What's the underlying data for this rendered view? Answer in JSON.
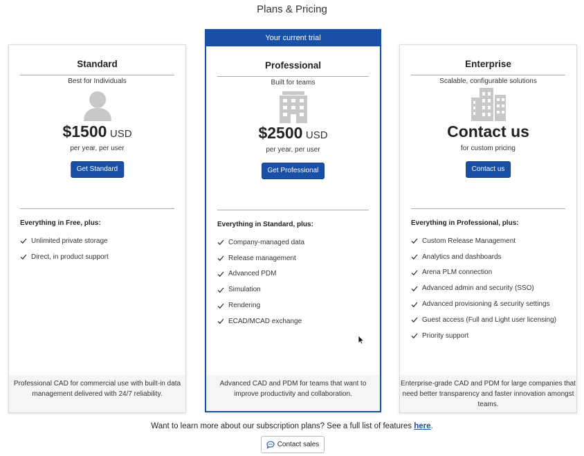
{
  "page": {
    "title": "Plans & Pricing"
  },
  "plans": [
    {
      "name": "Standard",
      "tagline": "Best for Individuals",
      "icon": "person-icon",
      "price": "$1500",
      "currency": "USD",
      "price_sub": "per year, per user",
      "cta": "Get Standard",
      "features_heading": "Everything in Free, plus:",
      "features": [
        "Unlimited private storage",
        "Direct, in product support"
      ],
      "description": "Professional CAD for commercial use with built-in data management delivered with 24/7 reliability."
    },
    {
      "banner": "Your current trial",
      "name": "Professional",
      "tagline": "Built for teams",
      "icon": "building-icon",
      "price": "$2500",
      "currency": "USD",
      "price_sub": "per year, per user",
      "cta": "Get Professional",
      "features_heading": "Everything in Standard, plus:",
      "features": [
        "Company-managed data",
        "Release management",
        "Advanced PDM",
        "Simulation",
        "Rendering",
        "ECAD/MCAD exchange"
      ],
      "description": "Advanced CAD and PDM for teams that want to improve productivity and collaboration."
    },
    {
      "name": "Enterprise",
      "tagline": "Scalable, configurable solutions",
      "icon": "city-icon",
      "price": "Contact us",
      "price_sub": "for custom pricing",
      "cta": "Contact us",
      "features_heading": "Everything in Professional, plus:",
      "features": [
        "Custom Release Management",
        "Analytics and dashboards",
        "Arena PLM connection",
        "Advanced admin and security (SSO)",
        "Advanced provisioning & security settings",
        "Guest access (Full and Light user licensing)",
        "Priority support"
      ],
      "description": "Enterprise-grade CAD and PDM for large companies that need better transparency and faster innovation amongst teams."
    }
  ],
  "footer": {
    "text": "Want to learn more about our subscription plans? See a full list of features",
    "link": "here",
    "period": ".",
    "contact_button": "Contact sales"
  },
  "colors": {
    "accent": "#1a4fa8",
    "icon_gray": "#c8c8c8"
  }
}
